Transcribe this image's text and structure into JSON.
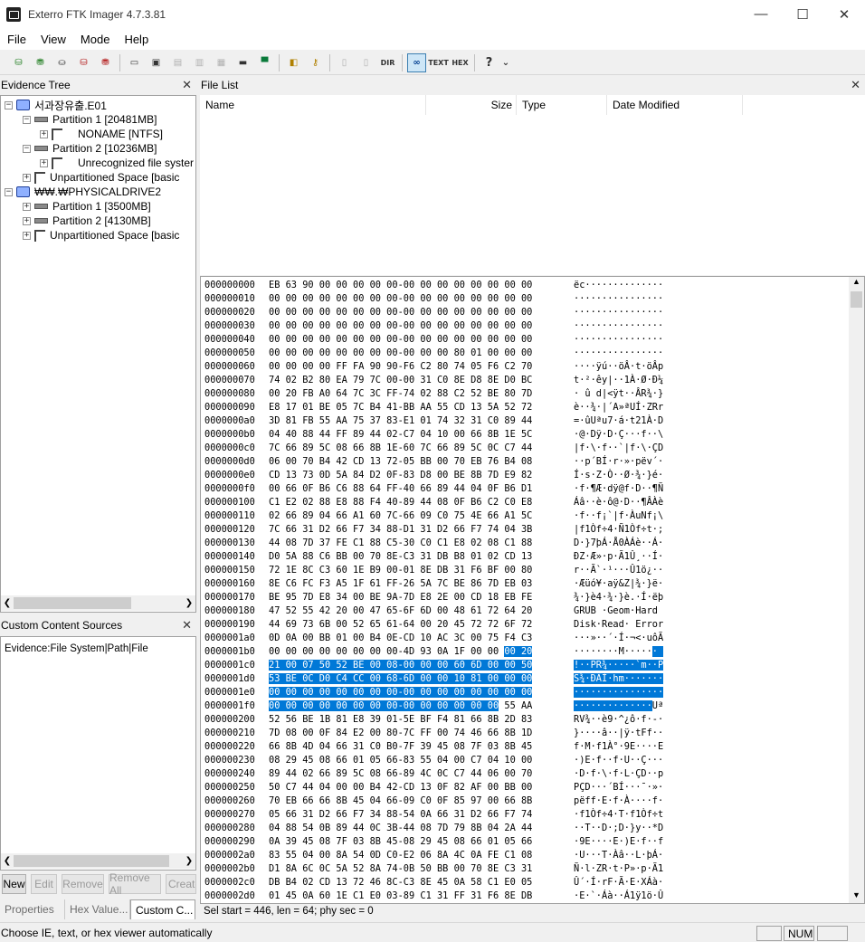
{
  "window": {
    "title": "Exterro FTK Imager 4.7.3.81",
    "minimize": "—",
    "maximize": "☐",
    "close": "✕"
  },
  "menu": [
    "File",
    "View",
    "Mode",
    "Help"
  ],
  "evidence_tree": {
    "title": "Evidence Tree",
    "close": "✕",
    "items": [
      {
        "label": "서과장유출.E01",
        "level": 0,
        "sign": "−",
        "icon": "drive-icon"
      },
      {
        "label": "Partition 1 [20481MB]",
        "level": 1,
        "sign": "−",
        "icon": "partition-icon"
      },
      {
        "label": "NONAME [NTFS]",
        "level": 2,
        "sign": "+",
        "icon": "filesystem-icon"
      },
      {
        "label": "Partition 2 [10236MB]",
        "level": 1,
        "sign": "−",
        "icon": "partition-icon"
      },
      {
        "label": "Unrecognized file syster",
        "level": 2,
        "sign": "+",
        "icon": "filesystem-icon"
      },
      {
        "label": "Unpartitioned Space [basic",
        "level": 1,
        "sign": "+",
        "icon": "filesystem-icon"
      },
      {
        "label": "₩₩.₩PHYSICALDRIVE2",
        "level": 0,
        "sign": "−",
        "icon": "drive-icon"
      },
      {
        "label": "Partition 1 [3500MB]",
        "level": 1,
        "sign": "+",
        "icon": "partition-icon"
      },
      {
        "label": "Partition 2 [4130MB]",
        "level": 1,
        "sign": "+",
        "icon": "partition-icon"
      },
      {
        "label": "Unpartitioned Space [basic",
        "level": 1,
        "sign": "+",
        "icon": "filesystem-icon"
      }
    ]
  },
  "custom_content": {
    "title": "Custom Content Sources",
    "close": "✕",
    "entry": "Evidence:File System|Path|File",
    "buttons": [
      {
        "label": "New",
        "enabled": true
      },
      {
        "label": "Edit",
        "enabled": false
      },
      {
        "label": "Remove",
        "enabled": false
      },
      {
        "label": "Remove All",
        "enabled": false
      },
      {
        "label": "Create",
        "enabled": false
      }
    ]
  },
  "bottom_tabs": [
    {
      "label": "Properties",
      "selected": false
    },
    {
      "label": "Hex Value...",
      "selected": false
    },
    {
      "label": "Custom C...",
      "selected": true
    }
  ],
  "file_list": {
    "title": "File List",
    "close": "✕",
    "columns": [
      "Name",
      "Size",
      "Type",
      "Date Modified"
    ]
  },
  "hex_view": {
    "lines": [
      {
        "off": "000000000",
        "hex": "EB 63 90 00 00 00 00 00-00 00 00 00 00 00 00 00",
        "ascii": "ëc··············"
      },
      {
        "off": "000000010",
        "hex": "00 00 00 00 00 00 00 00-00 00 00 00 00 00 00 00",
        "ascii": "················"
      },
      {
        "off": "000000020",
        "hex": "00 00 00 00 00 00 00 00-00 00 00 00 00 00 00 00",
        "ascii": "················"
      },
      {
        "off": "000000030",
        "hex": "00 00 00 00 00 00 00 00-00 00 00 00 00 00 00 00",
        "ascii": "················"
      },
      {
        "off": "000000040",
        "hex": "00 00 00 00 00 00 00 00-00 00 00 00 00 00 00 00",
        "ascii": "················"
      },
      {
        "off": "000000050",
        "hex": "00 00 00 00 00 00 00 00-00 00 00 80 01 00 00 00",
        "ascii": "················"
      },
      {
        "off": "000000060",
        "hex": "00 00 00 00 FF FA 90 90-F6 C2 80 74 05 F6 C2 70",
        "ascii": "····ÿú··öÂ·t·öÂp"
      },
      {
        "off": "000000070",
        "hex": "74 02 B2 80 EA 79 7C 00-00 31 C0 8E D8 8E D0 BC",
        "ascii": "t·²·êy|··1À·Ø·Ð¼"
      },
      {
        "off": "000000080",
        "hex": "00 20 FB A0 64 7C 3C FF-74 02 88 C2 52 BE 80 7D",
        "ascii": "· û d|<ÿt··ÂR¾·}"
      },
      {
        "off": "000000090",
        "hex": "E8 17 01 BE 05 7C B4 41-BB AA 55 CD 13 5A 52 72",
        "ascii": "è··¾·|´A»ªUÍ·ZRr"
      },
      {
        "off": "0000000a0",
        "hex": "3D 81 FB 55 AA 75 37 83-E1 01 74 32 31 C0 89 44",
        "ascii": "=·ûUªu7·á·t21À·D"
      },
      {
        "off": "0000000b0",
        "hex": "04 40 88 44 FF 89 44 02-C7 04 10 00 66 8B 1E 5C",
        "ascii": "·@·Dÿ·D·Ç···f··\\"
      },
      {
        "off": "0000000c0",
        "hex": "7C 66 89 5C 08 66 8B 1E-60 7C 66 89 5C 0C C7 44",
        "ascii": "|f·\\·f··`|f·\\·ÇD"
      },
      {
        "off": "0000000d0",
        "hex": "06 00 70 B4 42 CD 13 72-05 BB 00 70 EB 76 B4 08",
        "ascii": "··p´BÍ·r·»·pëv´·"
      },
      {
        "off": "0000000e0",
        "hex": "CD 13 73 0D 5A 84 D2 0F-83 D8 00 BE 8B 7D E9 82",
        "ascii": "Í·s·Z·Ò··Ø·¾·}é·"
      },
      {
        "off": "0000000f0",
        "hex": "00 66 0F B6 C6 88 64 FF-40 66 89 44 04 0F B6 D1",
        "ascii": "·f·¶Æ·dÿ@f·D··¶Ñ"
      },
      {
        "off": "000000100",
        "hex": "C1 E2 02 88 E8 88 F4 40-89 44 08 0F B6 C2 C0 E8",
        "ascii": "Áâ··è·ô@·D··¶ÂÀè"
      },
      {
        "off": "000000110",
        "hex": "02 66 89 04 66 A1 60 7C-66 09 C0 75 4E 66 A1 5C",
        "ascii": "·f··f¡`|f·ÀuNf¡\\"
      },
      {
        "off": "000000120",
        "hex": "7C 66 31 D2 66 F7 34 88-D1 31 D2 66 F7 74 04 3B",
        "ascii": "|f1Òf÷4·Ñ1Òf÷t·;"
      },
      {
        "off": "000000130",
        "hex": "44 08 7D 37 FE C1 88 C5-30 C0 C1 E8 02 08 C1 88",
        "ascii": "D·}7þÁ·Å0ÀÁè··Á·"
      },
      {
        "off": "000000140",
        "hex": "D0 5A 88 C6 BB 00 70 8E-C3 31 DB B8 01 02 CD 13",
        "ascii": "ÐZ·Æ»·p·Ã1Û¸··Í·"
      },
      {
        "off": "000000150",
        "hex": "72 1E 8C C3 60 1E B9 00-01 8E DB 31 F6 BF 00 80",
        "ascii": "r··Ã`·¹···Û1ö¿··"
      },
      {
        "off": "000000160",
        "hex": "8E C6 FC F3 A5 1F 61 FF-26 5A 7C BE 86 7D EB 03",
        "ascii": "·Æüó¥·aÿ&Z|¾·}ë·"
      },
      {
        "off": "000000170",
        "hex": "BE 95 7D E8 34 00 BE 9A-7D E8 2E 00 CD 18 EB FE",
        "ascii": "¾·}è4·¾·}è.·Í·ëþ"
      },
      {
        "off": "000000180",
        "hex": "47 52 55 42 20 00 47 65-6F 6D 00 48 61 72 64 20",
        "ascii": "GRUB ·Geom·Hard "
      },
      {
        "off": "000000190",
        "hex": "44 69 73 6B 00 52 65 61-64 00 20 45 72 72 6F 72",
        "ascii": "Disk·Read· Error"
      },
      {
        "off": "0000001a0",
        "hex": "0D 0A 00 BB 01 00 B4 0E-CD 10 AC 3C 00 75 F4 C3",
        "ascii": "···»··´·Í·¬<·uôÃ"
      },
      {
        "off": "0000001b0",
        "hex": "00 00 00 00 00 00 00 00-4D 93 0A 1F 00 00 00 20",
        "ascii": "········M······ ",
        "sel_from": 14
      },
      {
        "off": "0000001c0",
        "hex": "21 00 07 50 52 BE 00 08-00 00 00 60 6D 00 00 50",
        "ascii": "!··PR¾·····`m··P",
        "sel_from": 0
      },
      {
        "off": "0000001d0",
        "hex": "53 BE 0C D0 C4 CC 00 68-6D 00 00 10 81 00 00 00",
        "ascii": "S¾·ÐÄÌ·hm·······",
        "sel_from": 0
      },
      {
        "off": "0000001e0",
        "hex": "00 00 00 00 00 00 00 00-00 00 00 00 00 00 00 00",
        "ascii": "················",
        "sel_from": 0
      },
      {
        "off": "0000001f0",
        "hex": "00 00 00 00 00 00 00 00-00 00 00 00 00 00 55 AA",
        "ascii": "··············Uª",
        "sel_to": 14
      },
      {
        "off": "000000200",
        "hex": "52 56 BE 1B 81 E8 39 01-5E BF F4 81 66 8B 2D 83",
        "ascii": "RV¾··è9·^¿ô·f·-·"
      },
      {
        "off": "000000210",
        "hex": "7D 08 00 0F 84 E2 00 80-7C FF 00 74 46 66 8B 1D",
        "ascii": "}····â··|ÿ·tFf··"
      },
      {
        "off": "000000220",
        "hex": "66 8B 4D 04 66 31 C0 B0-7F 39 45 08 7F 03 8B 45",
        "ascii": "f·M·f1À°·9E····E"
      },
      {
        "off": "000000230",
        "hex": "08 29 45 08 66 01 05 66-83 55 04 00 C7 04 10 00",
        "ascii": "·)E·f··f·U··Ç···"
      },
      {
        "off": "000000240",
        "hex": "89 44 02 66 89 5C 08 66-89 4C 0C C7 44 06 00 70",
        "ascii": "·D·f·\\·f·L·ÇD··p"
      },
      {
        "off": "000000250",
        "hex": "50 C7 44 04 00 00 B4 42-CD 13 0F 82 AF 00 BB 00",
        "ascii": "PÇD···´BÍ···¯·»·"
      },
      {
        "off": "000000260",
        "hex": "70 EB 66 66 8B 45 04 66-09 C0 0F 85 97 00 66 8B",
        "ascii": "pëff·E·f·À····f·"
      },
      {
        "off": "000000270",
        "hex": "05 66 31 D2 66 F7 34 88-54 0A 66 31 D2 66 F7 74",
        "ascii": "·f1Òf÷4·T·f1Òf÷t"
      },
      {
        "off": "000000280",
        "hex": "04 88 54 0B 89 44 0C 3B-44 08 7D 79 8B 04 2A 44",
        "ascii": "··T··D·;D·}y··*D"
      },
      {
        "off": "000000290",
        "hex": "0A 39 45 08 7F 03 8B 45-08 29 45 08 66 01 05 66",
        "ascii": "·9E····E·)E·f··f"
      },
      {
        "off": "0000002a0",
        "hex": "83 55 04 00 8A 54 0D C0-E2 06 8A 4C 0A FE C1 08",
        "ascii": "·U···T·Àâ··L·þÁ·"
      },
      {
        "off": "0000002b0",
        "hex": "D1 8A 6C 0C 5A 52 8A 74-0B 50 BB 00 70 8E C3 31",
        "ascii": "Ñ·l·ZR·t·P»·p·Ã1"
      },
      {
        "off": "0000002c0",
        "hex": "DB B4 02 CD 13 72 46 8C-C3 8E 45 0A 58 C1 E0 05",
        "ascii": "Û´·Í·rF·Ã·E·XÁà·"
      },
      {
        "off": "0000002d0",
        "hex": "01 45 0A 60 1E C1 E0 03-89 C1 31 FF 31 F6 8E DB",
        "ascii": "·E·`·Áà··Á1ÿ1ö·Û"
      }
    ]
  },
  "selection_status": "Sel start = 446, len = 64; phy sec = 0",
  "statusbar": {
    "text": "Choose IE, text, or hex viewer automatically",
    "num": "NUM"
  }
}
